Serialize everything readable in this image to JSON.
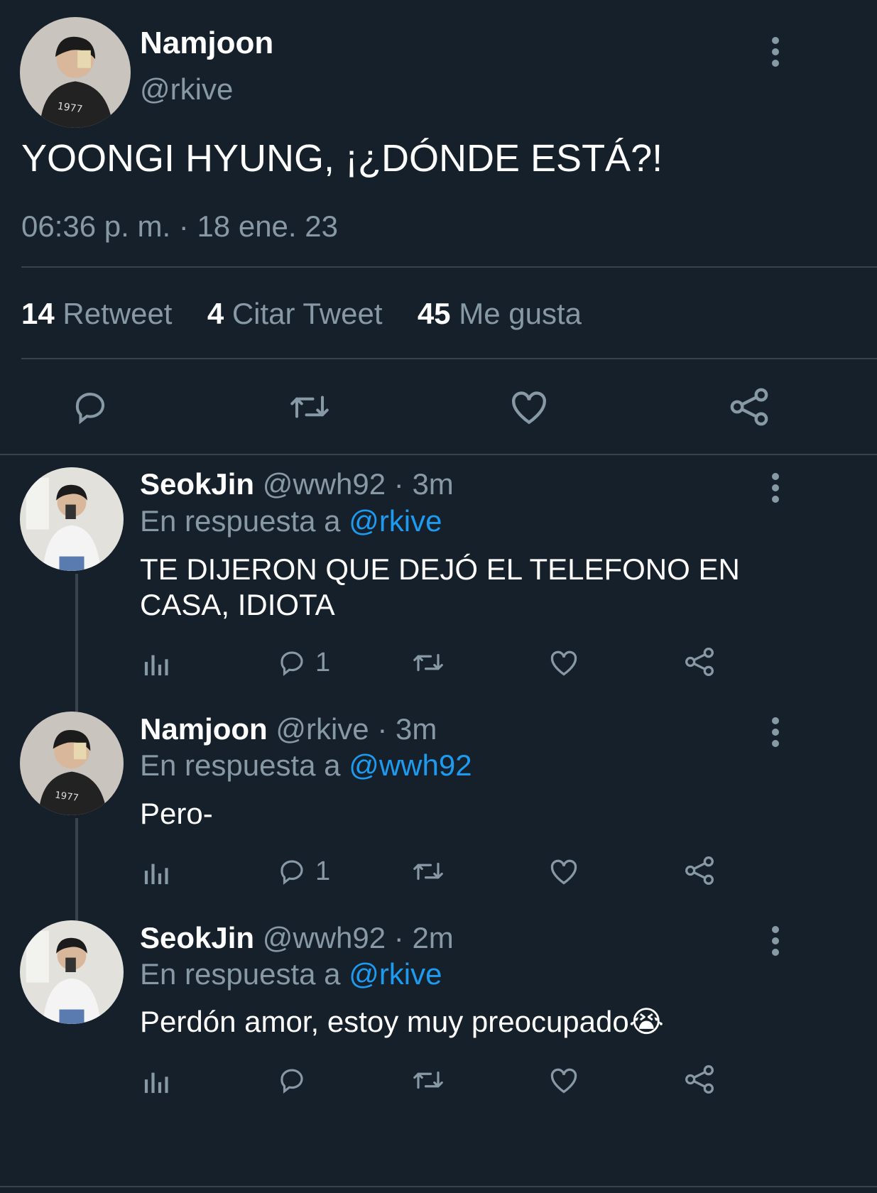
{
  "main_tweet": {
    "name": "Namjoon",
    "handle": "@rkive",
    "text": "YOONGI HYUNG, ¡¿DÓNDE ESTÁ?!",
    "timestamp": "06:36 p. m. · 18 ene. 23",
    "stats": {
      "retweets": "14",
      "retweets_label": "Retweet",
      "quotes": "4",
      "quotes_label": "Citar Tweet",
      "likes": "45",
      "likes_label": "Me gusta"
    },
    "actions": [
      "reply-icon",
      "retweet-icon",
      "heart-icon",
      "share-icon"
    ]
  },
  "replies": [
    {
      "name": "SeokJin",
      "meta": "@wwh92 · 3m",
      "reply_prefix": "En respuesta a",
      "reply_to": "@rkive",
      "text_line1": "TE DIJERON QUE DEJÓ EL TELEFONO EN",
      "text_line2": "CASA, IDIOTA",
      "reply_count": "1"
    },
    {
      "name": "Namjoon",
      "meta": "@rkive · 3m",
      "reply_prefix": "En respuesta a",
      "reply_to": "@wwh92",
      "text_line1": "Pero-",
      "text_line2": "",
      "reply_count": "1"
    },
    {
      "name": "SeokJin",
      "meta": "@wwh92 · 2m",
      "reply_prefix": "En respuesta a",
      "reply_to": "@rkive",
      "text_line1": "Perdón amor, estoy muy preocupado😭",
      "text_line2": "",
      "reply_count": ""
    }
  ],
  "colors": {
    "background": "#15202b",
    "muted": "#8899a6",
    "link": "#1d9bf0",
    "divider": "#38444d"
  }
}
